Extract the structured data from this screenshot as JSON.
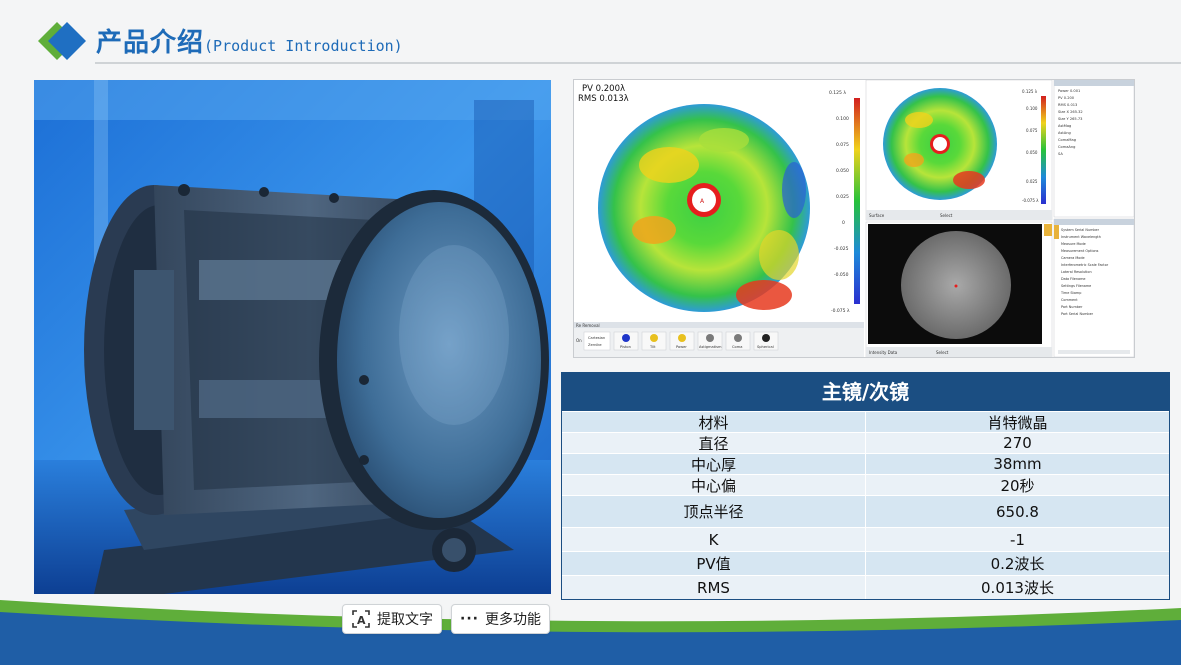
{
  "header": {
    "title_cn": "产品介绍",
    "title_en": "(Product Introduction)"
  },
  "measurement": {
    "main_map": {
      "pv": "PV 0.200λ",
      "rms": "RMS 0.013λ",
      "scale_max": "0.125 λ",
      "scale_min": "-0.075 λ",
      "scale_ticks": [
        "0.100",
        "0.075",
        "0.050",
        "0.025",
        "0",
        "-0.025",
        "-0.050"
      ]
    },
    "terms_panel": {
      "title": "Re Removal",
      "options": [
        "Cartesian",
        "Zernike"
      ],
      "buttons": [
        "Piston",
        "Tilt",
        "Power",
        "Astigmatism",
        "Coma",
        "Spherical"
      ]
    },
    "secondary_map": {
      "scale_max": "0.125 λ",
      "scale_ticks": [
        "0.100",
        "0.075",
        "0.050",
        "0.025"
      ],
      "scale_min": "-0.075 λ",
      "status": "Surface",
      "select": "Select"
    },
    "intensity": {
      "status": "Intensity Data",
      "select": "Select"
    },
    "results_panel": {
      "rows": [
        "Power  0.001",
        "PV  0.200",
        "RMS  0.013",
        "Size X  265.32",
        "Size Y  265.73",
        "AstMag",
        "AstAng",
        "ComaMag",
        "ComaAng",
        "SA"
      ]
    },
    "info_panel": {
      "rows": [
        "System Serial Number",
        "Instrument Wavelength",
        "Measure Mode",
        "Measurement Options",
        "Camera Mode",
        "Interferometric Scale Factor",
        "Lateral Resolution",
        "Data Filename",
        "Settings Filename",
        "Time Stamp",
        "Comment",
        "Part Number",
        "Part Serial Number"
      ]
    }
  },
  "spec_table": {
    "title": "主镜/次镜",
    "rows": [
      {
        "label": "材料",
        "value": "肖特微晶"
      },
      {
        "label": "直径",
        "value": "270"
      },
      {
        "label": "中心厚",
        "value": "38mm"
      },
      {
        "label": "中心偏",
        "value": "20秒"
      },
      {
        "label": "顶点半径",
        "value": "650.8"
      },
      {
        "label": "K",
        "value": "-1"
      },
      {
        "label": "PV值",
        "value": "0.2波长"
      },
      {
        "label": "RMS",
        "value": "0.013波长"
      }
    ]
  },
  "toolbar": {
    "extract_text": "提取文字",
    "more": "更多功能"
  },
  "colors": {
    "title_blue": "#1e6bb8",
    "table_header": "#1b4e82",
    "row_odd": "#d6e6f2",
    "row_even": "#eaf1f7",
    "bottom_blue": "#1f5ea6",
    "bottom_green": "#5fae3a"
  }
}
